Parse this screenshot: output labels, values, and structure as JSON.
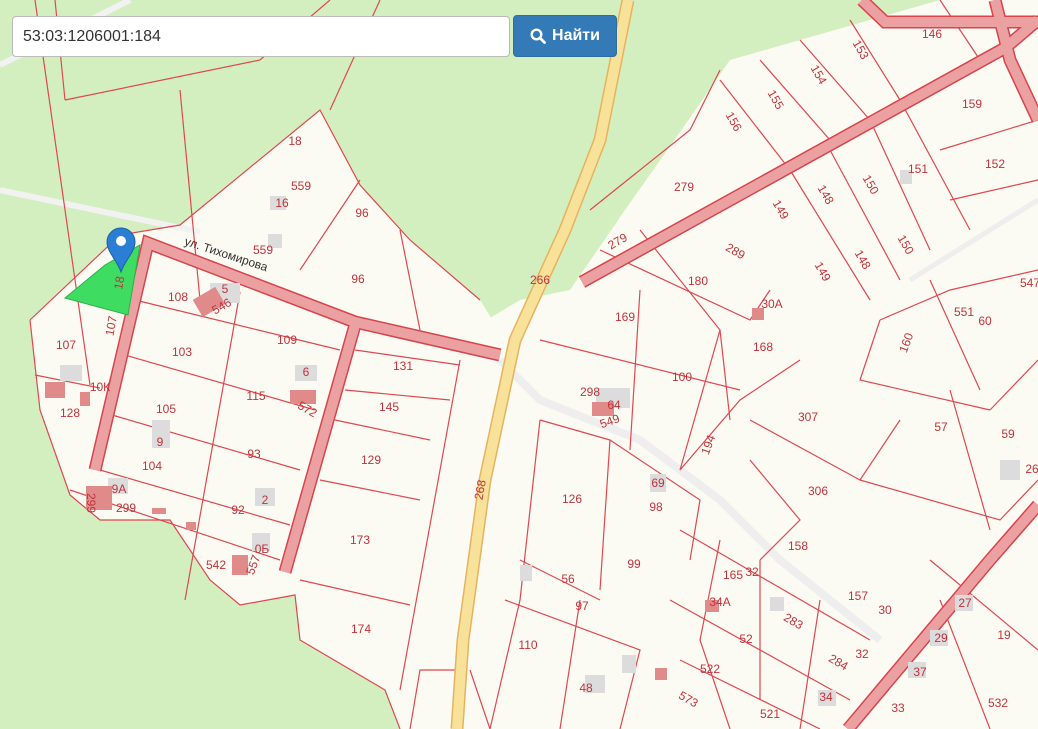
{
  "search": {
    "value": "53:03:1206001:184",
    "button_label": "Найти",
    "button_icon": "search-icon"
  },
  "map": {
    "street_name": "ул. Тихомирова",
    "selected_parcel_label": "184",
    "colors": {
      "parcel_border": "#e0474f",
      "road_fill": "#e89a9a",
      "selected_parcel": "#3fdc62",
      "marker": "#2a7fd4",
      "forest": "#d4efbf",
      "settlement": "#fbfbf3",
      "highway": "#f6dc85"
    },
    "parcel_labels": [
      "146",
      "153",
      "154",
      "155",
      "156",
      "159",
      "152",
      "151",
      "150",
      "148",
      "150",
      "148",
      "149",
      "149",
      "279",
      "279",
      "289",
      "180",
      "30А",
      "168",
      "169",
      "100",
      "298",
      "64",
      "549",
      "194",
      "307",
      "57",
      "59",
      "26",
      "306",
      "158",
      "157",
      "30",
      "165",
      "32",
      "34А",
      "283",
      "284",
      "32",
      "52",
      "522",
      "521",
      "34",
      "573",
      "33",
      "532",
      "27",
      "29",
      "19",
      "37",
      "547",
      "551",
      "60",
      "160",
      "266",
      "268",
      "126",
      "98",
      "69",
      "99",
      "56",
      "97",
      "110",
      "48",
      "131",
      "145",
      "129",
      "173",
      "174",
      "96",
      "96",
      "559",
      "16",
      "559",
      "18",
      "108",
      "5",
      "546",
      "109",
      "103",
      "115",
      "6",
      "572",
      "107",
      "107",
      "10К",
      "128",
      "105",
      "9",
      "104",
      "93",
      "9А",
      "299",
      "299",
      "2",
      "92",
      "0Б",
      "557",
      "542",
      "18"
    ]
  }
}
